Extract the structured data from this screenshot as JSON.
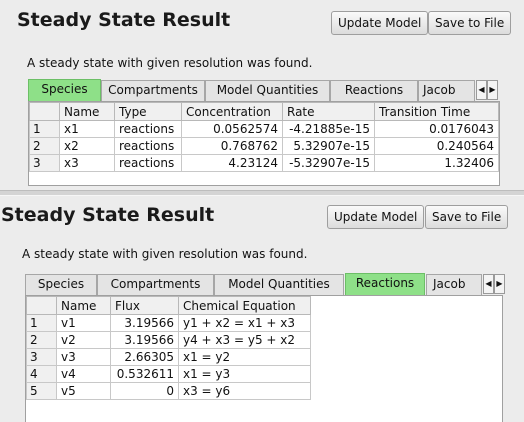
{
  "top": {
    "title": "Steady State Result",
    "update_button": "Update Model",
    "save_button": "Save to File",
    "status": "A steady state with given resolution was found.",
    "tabs": [
      "Species",
      "Compartments",
      "Model Quantities",
      "Reactions",
      "Jacob"
    ],
    "active_tab": "Species",
    "columns": [
      "Name",
      "Type",
      "Concentration",
      "Rate",
      "Transition Time"
    ],
    "rows": [
      {
        "index": "1",
        "name": "x1",
        "type": "reactions",
        "concentration": "0.0562574",
        "rate": "-4.21885e-15",
        "transition_time": "0.0176043"
      },
      {
        "index": "2",
        "name": "x2",
        "type": "reactions",
        "concentration": "0.768762",
        "rate": "5.32907e-15",
        "transition_time": "0.240564"
      },
      {
        "index": "3",
        "name": "x3",
        "type": "reactions",
        "concentration": "4.23124",
        "rate": "-5.32907e-15",
        "transition_time": "1.32406"
      }
    ]
  },
  "bottom": {
    "title": "Steady State Result",
    "update_button": "Update Model",
    "save_button": "Save to File",
    "status": "A steady state with given resolution was found.",
    "tabs": [
      "Species",
      "Compartments",
      "Model Quantities",
      "Reactions",
      "Jacob"
    ],
    "active_tab": "Reactions",
    "columns": [
      "Name",
      "Flux",
      "Chemical Equation"
    ],
    "rows": [
      {
        "index": "1",
        "name": "v1",
        "flux": "3.19566",
        "equation": "y1 + x2 = x1 + x3"
      },
      {
        "index": "2",
        "name": "v2",
        "flux": "3.19566",
        "equation": "y4 + x3 = y5 + x2"
      },
      {
        "index": "3",
        "name": "v3",
        "flux": "2.66305",
        "equation": "x1 = y2"
      },
      {
        "index": "4",
        "name": "v4",
        "flux": "0.532611",
        "equation": "x1 = y3"
      },
      {
        "index": "5",
        "name": "v5",
        "flux": "0",
        "equation": "x3 = y6"
      }
    ]
  },
  "icons": {
    "tab_scroll_left": "◀",
    "tab_scroll_right": "▶"
  },
  "colors": {
    "active_tab": "#8ee088",
    "panel_bg": "#ececec"
  }
}
